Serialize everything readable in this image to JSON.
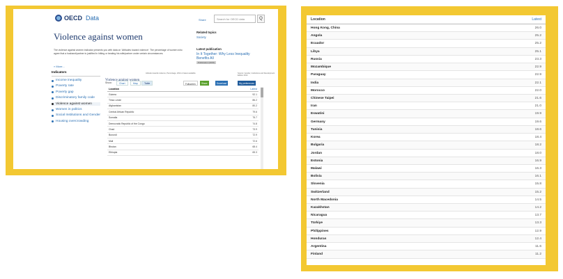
{
  "page": {
    "site_name": "OECD",
    "site_section": "Data",
    "share_link": "Share",
    "search_placeholder": "Search for OECD data",
    "search_button": "Q",
    "title": "Violence against women",
    "description": "The violence against women indicator presents you with data on 'Attitudes toward violence': The percentage of women who agree that a husband/partner is justified in hitting or beating his wife/partner under certain circumstances.",
    "more_link": "» More...",
    "related_heading": "Related topics",
    "related_item": "Society",
    "latest_heading": "Latest publication",
    "latest_item": "In It Together: Why Less Inequality Benefits All",
    "latest_badge": "Publication (2015)"
  },
  "indicators": {
    "heading": "Indicators",
    "items": [
      {
        "label": "Income inequality",
        "active": false
      },
      {
        "label": "Poverty rate",
        "active": false
      },
      {
        "label": "Poverty gap",
        "active": false
      },
      {
        "label": "Discriminatory family code",
        "active": false
      },
      {
        "label": "Violence against women",
        "active": true
      },
      {
        "label": "Women in politics",
        "active": false
      },
      {
        "label": "Social Institutions and Gender",
        "active": false
      },
      {
        "label": "Housing overcrowding",
        "active": false
      }
    ]
  },
  "chart_panel": {
    "title": "Violence against women",
    "subtitle": "Attitude towards violence, Percentage, 2014 or latest available",
    "source": "Source: Gender, Institutions and Development Edition 2014",
    "show_label": "Show:",
    "tabs": [
      "Chart",
      "Map",
      "Table"
    ],
    "selected_tab": "Table",
    "fullscreen": "Fullscreen",
    "share_button": "Share",
    "download_button": "Download",
    "my_prefs_button": "My preferences",
    "col_location": "Location",
    "col_latest": "Latest",
    "rows": [
      {
        "loc": "Guinea",
        "val": "92.1"
      },
      {
        "loc": "Timor-Leste",
        "val": "86.2"
      },
      {
        "loc": "Afghanistan",
        "val": "80.2"
      },
      {
        "loc": "Central African Republic",
        "val": "79.6"
      },
      {
        "loc": "Somalia",
        "val": "75.7"
      },
      {
        "loc": "Democratic Republic of the Congo",
        "val": "74.8"
      },
      {
        "loc": "Chad",
        "val": "73.9"
      },
      {
        "loc": "Burundi",
        "val": "72.9"
      },
      {
        "loc": "Mali",
        "val": "72.6"
      },
      {
        "loc": "Bhutan",
        "val": "68.4"
      },
      {
        "loc": "Ethiopia",
        "val": "65.3"
      }
    ]
  },
  "right_table": {
    "col_location": "Location",
    "col_latest": "Latest",
    "rows": [
      {
        "loc": "Hong Kong, China",
        "val": "26.0"
      },
      {
        "loc": "Angola",
        "val": "25.2"
      },
      {
        "loc": "Ecuador",
        "val": "25.2"
      },
      {
        "loc": "Libya",
        "val": "25.1"
      },
      {
        "loc": "Russia",
        "val": "23.3"
      },
      {
        "loc": "Mozambique",
        "val": "22.9"
      },
      {
        "loc": "Paraguay",
        "val": "22.9"
      },
      {
        "loc": "India",
        "val": "22.1"
      },
      {
        "loc": "Morocco",
        "val": "22.0"
      },
      {
        "loc": "Chinese Taipei",
        "val": "21.6"
      },
      {
        "loc": "Iran",
        "val": "21.0"
      },
      {
        "loc": "Eswatini",
        "val": "19.9"
      },
      {
        "loc": "Germany",
        "val": "19.6"
      },
      {
        "loc": "Tunisia",
        "val": "18.6"
      },
      {
        "loc": "Korea",
        "val": "18.4"
      },
      {
        "loc": "Bulgaria",
        "val": "18.2"
      },
      {
        "loc": "Jordan",
        "val": "18.0"
      },
      {
        "loc": "Estonia",
        "val": "16.9"
      },
      {
        "loc": "Malawi",
        "val": "16.3"
      },
      {
        "loc": "Bolivia",
        "val": "16.1"
      },
      {
        "loc": "Slovenia",
        "val": "15.8"
      },
      {
        "loc": "Switzerland",
        "val": "15.2"
      },
      {
        "loc": "North Macedonia",
        "val": "14.5"
      },
      {
        "loc": "Kazakhstan",
        "val": "14.2"
      },
      {
        "loc": "Nicaragua",
        "val": "13.7"
      },
      {
        "loc": "Türkiye",
        "val": "13.3"
      },
      {
        "loc": "Philippines",
        "val": "12.9"
      },
      {
        "loc": "Honduras",
        "val": "12.4"
      },
      {
        "loc": "Argentina",
        "val": "11.6"
      },
      {
        "loc": "Finland",
        "val": "11.2"
      }
    ]
  },
  "colors": {
    "frame": "#f3c832",
    "brand_blue": "#1e3a6e",
    "link_blue": "#2a6fb3",
    "share_green": "#5aa02c",
    "download_blue": "#2a6fb3"
  }
}
